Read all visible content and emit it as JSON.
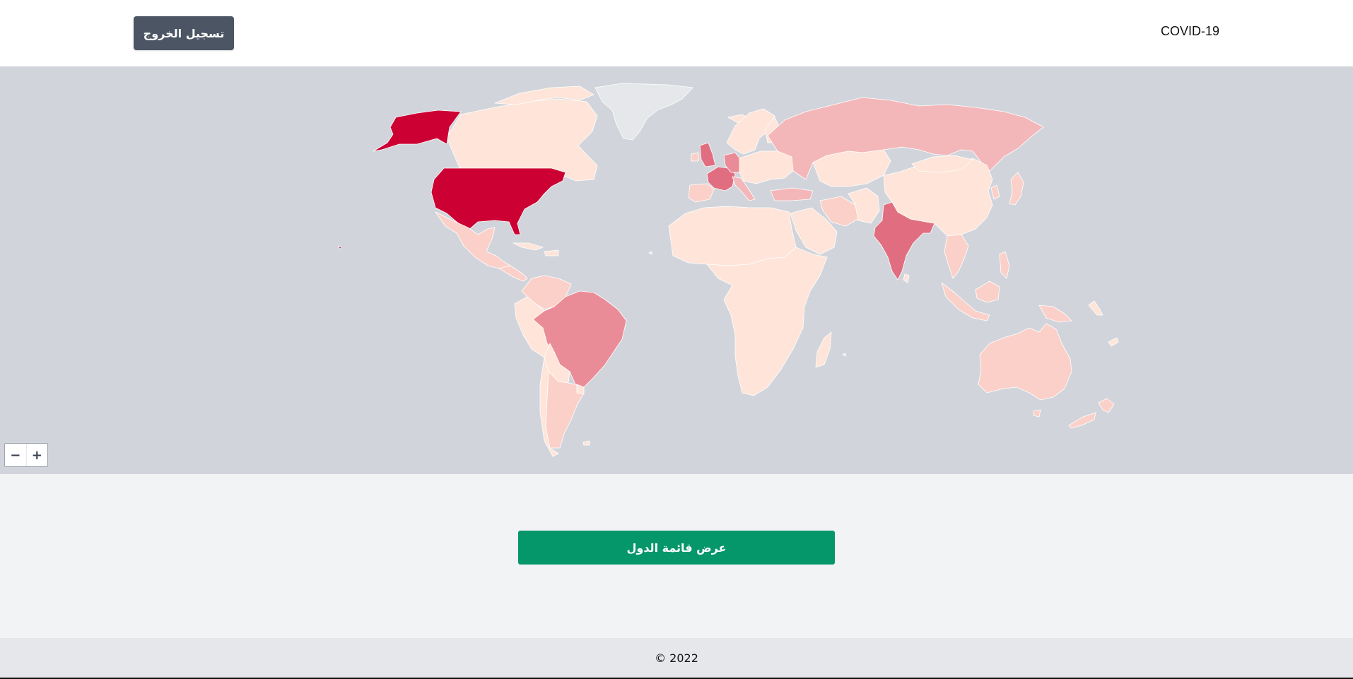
{
  "header": {
    "logout_label": "تسجيل الخروج",
    "brand": "COVID-19"
  },
  "map": {
    "zoom_out_label": "−",
    "zoom_in_label": "+",
    "colors": {
      "ocean": "#d1d5db",
      "no_data": "#e5e7eb",
      "level_1": "#fee4d9",
      "level_2": "#fbd0c9",
      "level_3": "#f4b7b9",
      "level_4": "#ea8c98",
      "level_5": "#e06e80",
      "level_max": "#cc0033"
    }
  },
  "main": {
    "countries_button_label": "عرض قائمة الدول"
  },
  "footer": {
    "copyright": "© 2022"
  }
}
